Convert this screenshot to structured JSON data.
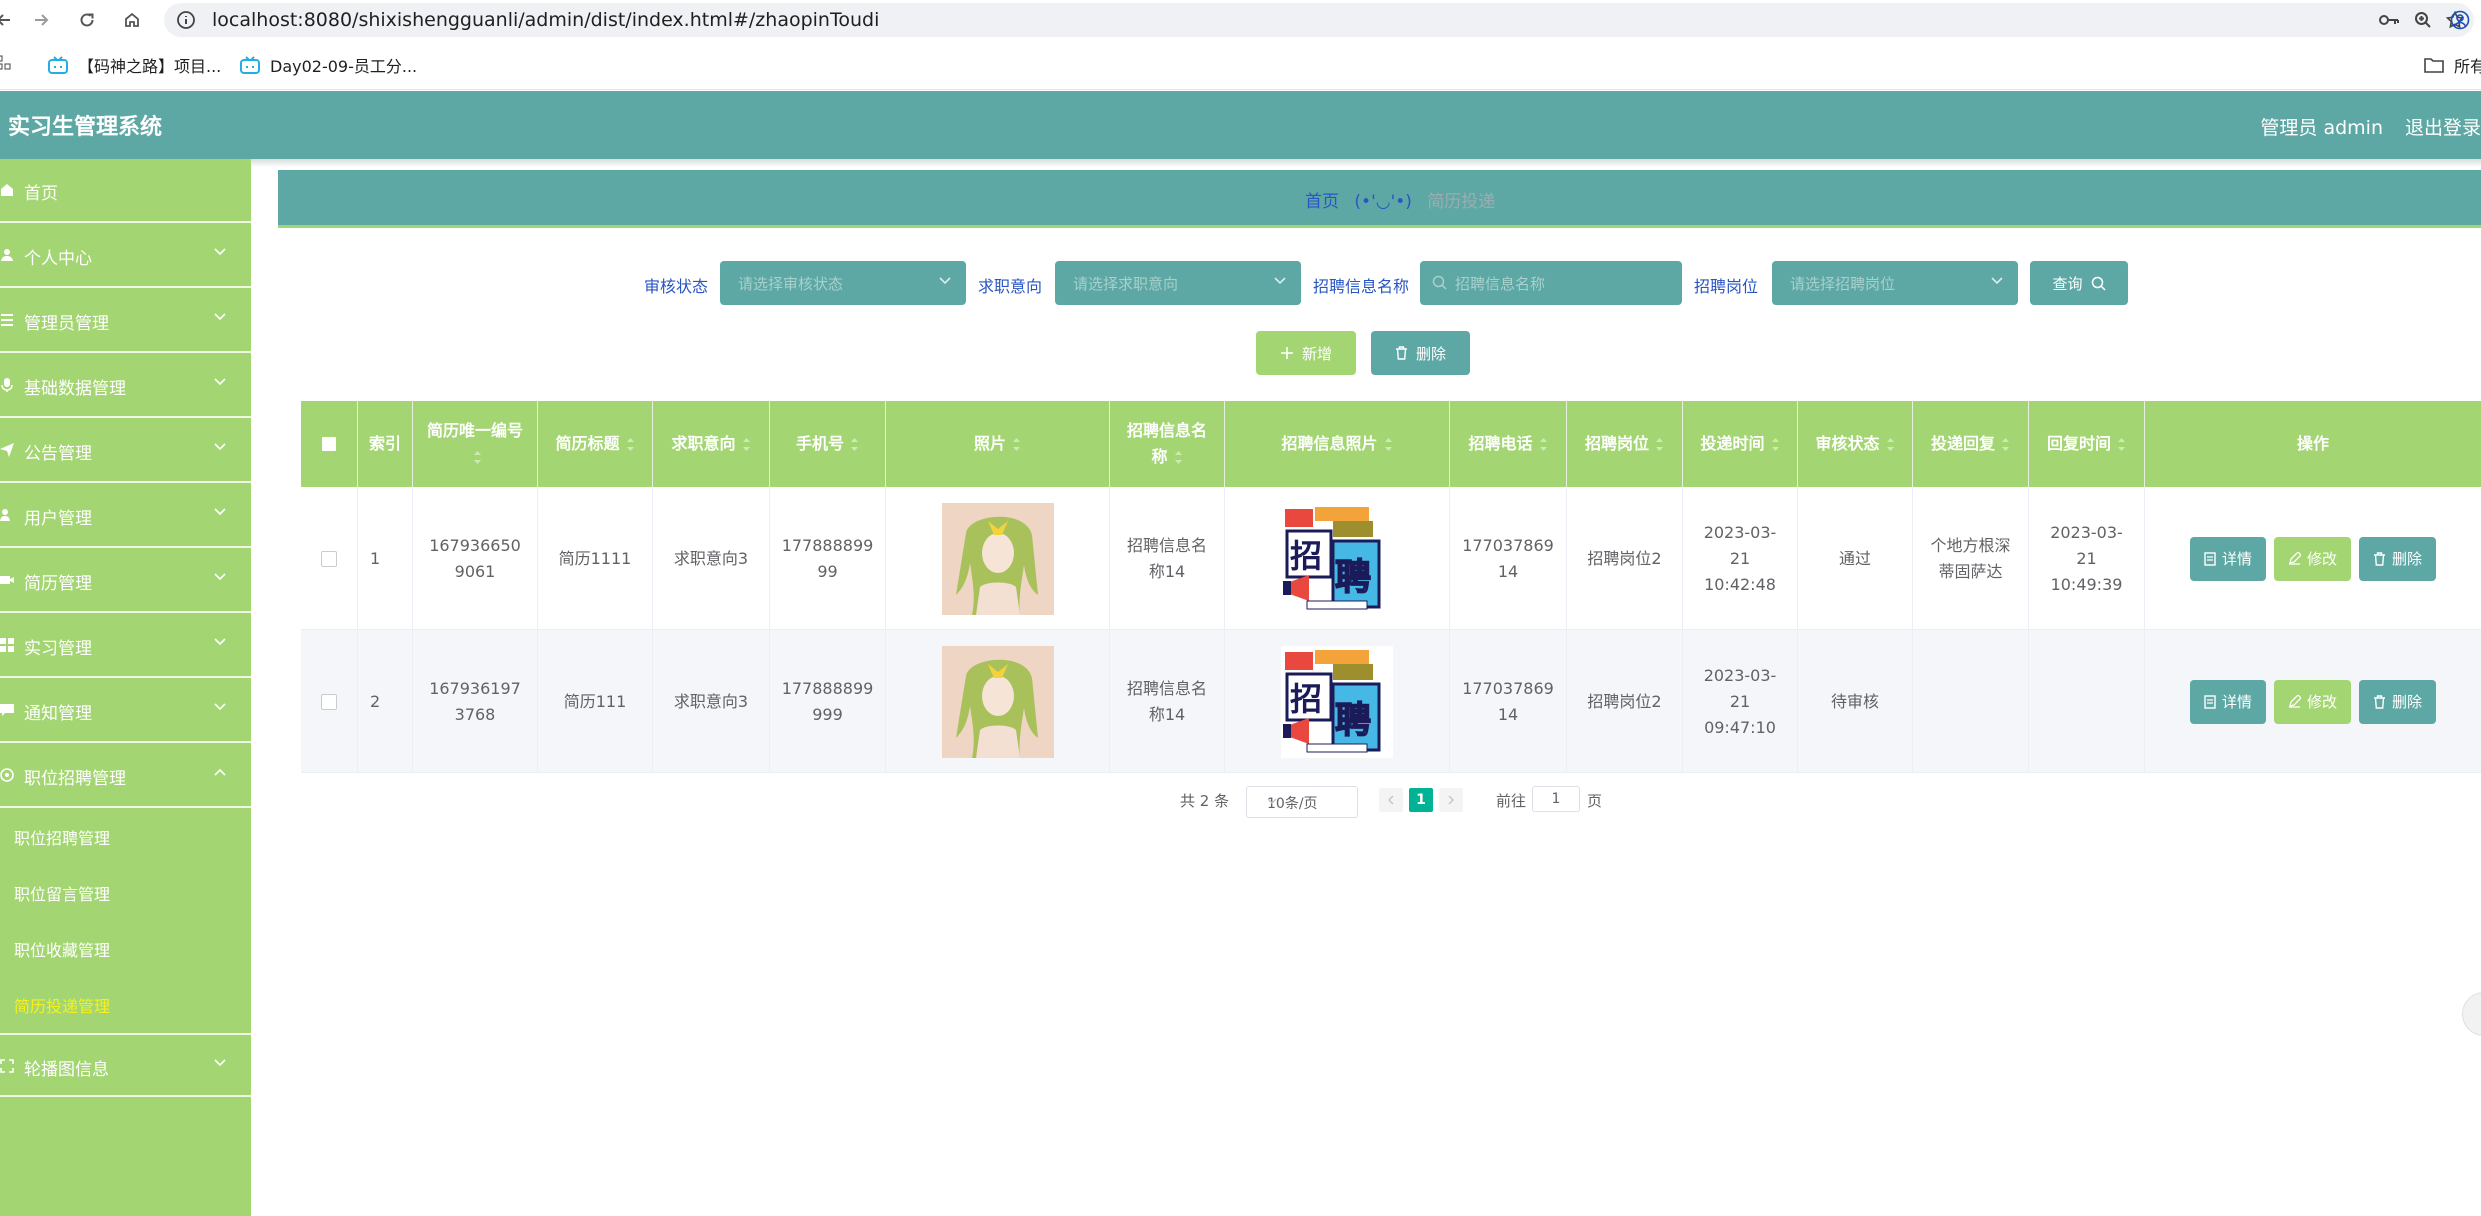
{
  "browser": {
    "url": "localhost:8080/shixishengguanli/admin/dist/index.html#/zhaopinToudi",
    "bookmarks": [
      "【码神之路】项目...",
      "Day02-09-员工分..."
    ],
    "bookmark_folder": "所有"
  },
  "header": {
    "title": "实习生管理系统",
    "user": "管理员 admin",
    "logout": "退出登录"
  },
  "sidebar": {
    "items": [
      {
        "label": "首页",
        "icon": "home-icon"
      },
      {
        "label": "个人中心",
        "icon": "user-icon"
      },
      {
        "label": "管理员管理",
        "icon": "list-icon"
      },
      {
        "label": "基础数据管理",
        "icon": "microphone-icon"
      },
      {
        "label": "公告管理",
        "icon": "send-icon"
      },
      {
        "label": "用户管理",
        "icon": "user-group-icon"
      },
      {
        "label": "简历管理",
        "icon": "video-icon"
      },
      {
        "label": "实习管理",
        "icon": "grid-icon"
      },
      {
        "label": "通知管理",
        "icon": "message-icon"
      },
      {
        "label": "职位招聘管理",
        "icon": "briefcase-icon"
      },
      {
        "label": "轮播图信息",
        "icon": "fullscreen-icon"
      }
    ],
    "subitems": [
      "职位招聘管理",
      "职位留言管理",
      "职位收藏管理",
      "简历投递管理"
    ]
  },
  "breadcrumb": {
    "home": "首页",
    "face": "(•'◡'•)",
    "current": "简历投递"
  },
  "search": {
    "audit_label": "审核状态",
    "audit_placeholder": "请选择审核状态",
    "intent_label": "求职意向",
    "intent_placeholder": "请选择求职意向",
    "name_label": "招聘信息名称",
    "name_placeholder": "招聘信息名称",
    "post_label": "招聘岗位",
    "post_placeholder": "请选择招聘岗位",
    "query_button": "查询"
  },
  "actions": {
    "add": "新增",
    "delete": "删除"
  },
  "table": {
    "columns": [
      "索引",
      "简历唯一编号",
      "简历标题",
      "求职意向",
      "手机号",
      "照片",
      "招聘信息名称",
      "招聘信息照片",
      "招聘电话",
      "招聘岗位",
      "投递时间",
      "审核状态",
      "投递回复",
      "回复时间",
      "操作"
    ],
    "rows": [
      {
        "index": "1",
        "resume_no": "1679366509061",
        "resume_title": "简历1111",
        "intent": "求职意向3",
        "phone": "17788889999",
        "job_name": "招聘信息名称14",
        "job_phone": "17703786914",
        "post": "招聘岗位2",
        "submit_time": "2023-03-21 10:42:48",
        "status": "通过",
        "reply": "个地方根深蒂固萨达",
        "reply_time": "2023-03-21 10:49:39"
      },
      {
        "index": "2",
        "resume_no": "1679361973768",
        "resume_title": "简历111",
        "intent": "求职意向3",
        "phone": "177888899999",
        "job_name": "招聘信息名称14",
        "job_phone": "17703786914",
        "post": "招聘岗位2",
        "submit_time": "2023-03-21 09:47:10",
        "status": "待审核",
        "reply": "",
        "reply_time": ""
      }
    ],
    "row_buttons": {
      "detail": "详情",
      "edit": "修改",
      "delete": "删除"
    }
  },
  "pagination": {
    "total": "共 2 条",
    "page_size": "10条/页",
    "current_page": "1",
    "goto_label": "前往",
    "goto_value": "1",
    "page_suffix": "页"
  },
  "colors": {
    "primary_teal": "#5da8a5",
    "accent_green": "#a3d672",
    "active_submenu": "#f7f01e",
    "link_blue": "#2a55c2"
  }
}
